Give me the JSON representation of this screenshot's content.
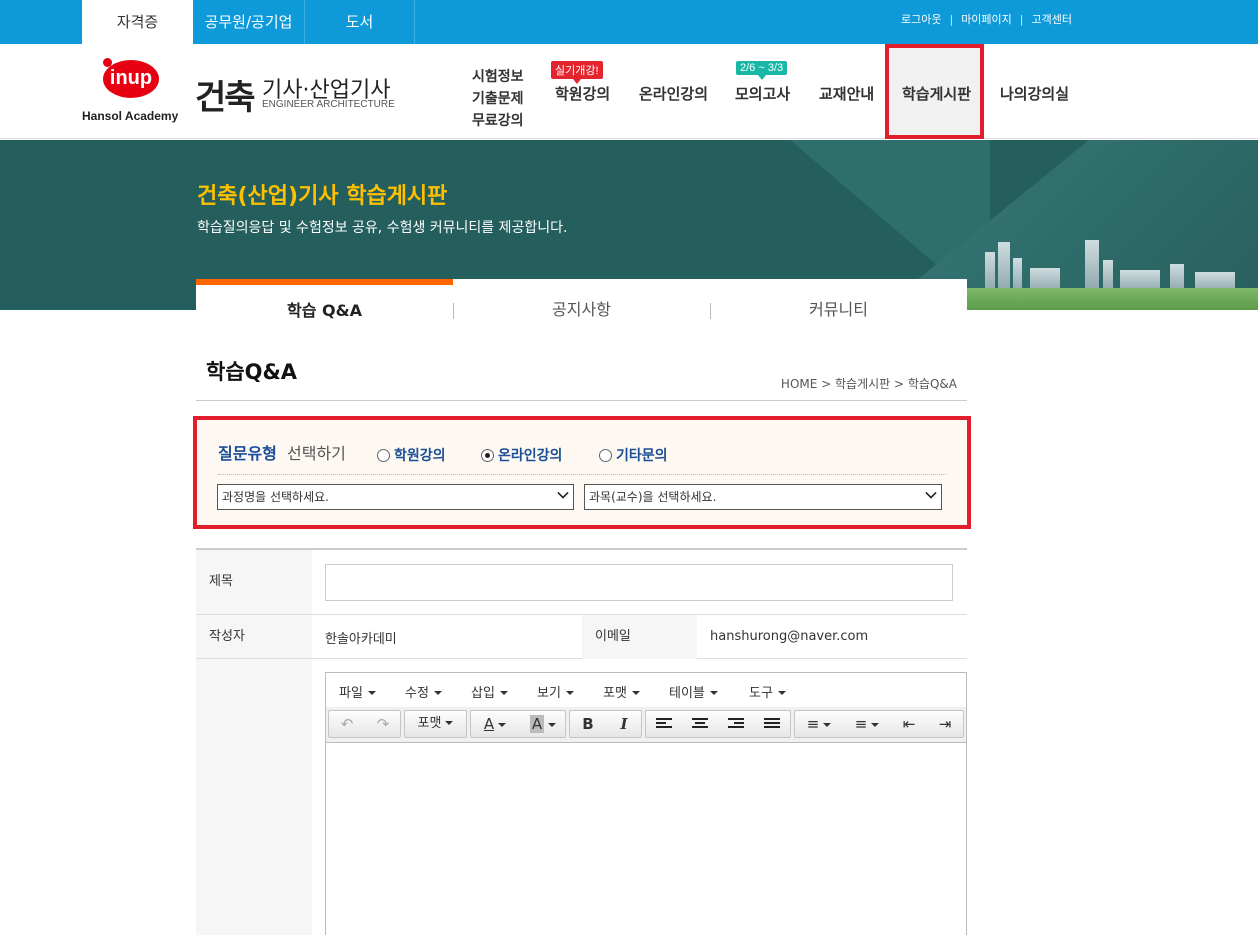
{
  "topbar": {
    "tabs": [
      "자격증",
      "공무원/공기업",
      "도서"
    ],
    "links": [
      "로그아웃",
      "마이페이지",
      "고객센터"
    ]
  },
  "logo": {
    "mark": "inup",
    "name": "Hansol Academy"
  },
  "brand": {
    "main": "건축",
    "sub": "기사·산업기사",
    "eng": "ENGINEER ARCHITECTURE"
  },
  "nav": {
    "small": [
      "시험정보",
      "기출문제",
      "무료강의"
    ],
    "items": [
      "학원강의",
      "온라인강의",
      "모의고사",
      "교재안내",
      "학습게시판",
      "나의강의실"
    ],
    "badge_academy": "실기개강!",
    "badge_mock": "2/6 ~ 3/3"
  },
  "banner": {
    "title": "건축(산업)기사 학습게시판",
    "desc": "학습질의응답 및 수험정보 공유, 수험생 커뮤니티를 제공합니다."
  },
  "subtabs": [
    "학습 Q&A",
    "공지사항",
    "커뮤니티"
  ],
  "page": {
    "title": "학습Q&A",
    "breadcrumb": "HOME > 학습게시판 > 학습Q&A"
  },
  "question": {
    "label_strong": "질문유형",
    "label_rest": "선택하기",
    "options": [
      "학원강의",
      "온라인강의",
      "기타문의"
    ],
    "selected": "온라인강의",
    "course_select": "과정명을 선택하세요.",
    "subject_select": "과목(교수)을 선택하세요."
  },
  "form": {
    "title_label": "제목",
    "title_value": "",
    "author_label": "작성자",
    "author_value": "한솔아카데미",
    "email_label": "이메일",
    "email_value": "hanshurong@naver.com"
  },
  "editor": {
    "menu": [
      "파일",
      "수정",
      "삽입",
      "보기",
      "포맷",
      "테이블",
      "도구"
    ],
    "format_label": "포맷",
    "bold": "B",
    "italic": "I",
    "color_a": "A"
  }
}
